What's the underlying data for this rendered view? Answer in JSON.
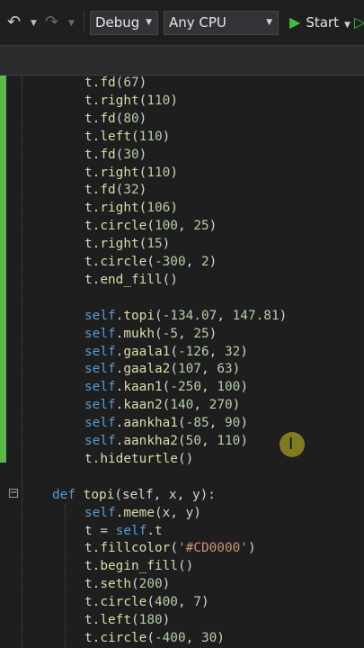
{
  "toolbar": {
    "undo_icon": "undo-icon",
    "redo_icon": "redo-icon",
    "configuration": "Debug",
    "platform": "Any CPU",
    "start_label": "Start",
    "start_icon": "play-icon",
    "accent_color": "#3fbf3f"
  },
  "editor": {
    "change_marker_color": "#5cb84a",
    "lines": [
      {
        "parts": [
          {
            "t": "t.",
            "c": ""
          },
          {
            "t": "fd",
            "c": "fn"
          },
          {
            "t": "(",
            "c": ""
          },
          {
            "t": "67",
            "c": "num"
          },
          {
            "t": ")",
            "c": ""
          }
        ]
      },
      {
        "parts": [
          {
            "t": "t.",
            "c": ""
          },
          {
            "t": "right",
            "c": "fn"
          },
          {
            "t": "(",
            "c": ""
          },
          {
            "t": "110",
            "c": "num"
          },
          {
            "t": ")",
            "c": ""
          }
        ]
      },
      {
        "parts": [
          {
            "t": "t.",
            "c": ""
          },
          {
            "t": "fd",
            "c": "fn"
          },
          {
            "t": "(",
            "c": ""
          },
          {
            "t": "80",
            "c": "num"
          },
          {
            "t": ")",
            "c": ""
          }
        ]
      },
      {
        "parts": [
          {
            "t": "t.",
            "c": ""
          },
          {
            "t": "left",
            "c": "fn"
          },
          {
            "t": "(",
            "c": ""
          },
          {
            "t": "110",
            "c": "num"
          },
          {
            "t": ")",
            "c": ""
          }
        ]
      },
      {
        "parts": [
          {
            "t": "t.",
            "c": ""
          },
          {
            "t": "fd",
            "c": "fn"
          },
          {
            "t": "(",
            "c": ""
          },
          {
            "t": "30",
            "c": "num"
          },
          {
            "t": ")",
            "c": ""
          }
        ]
      },
      {
        "parts": [
          {
            "t": "t.",
            "c": ""
          },
          {
            "t": "right",
            "c": "fn"
          },
          {
            "t": "(",
            "c": ""
          },
          {
            "t": "110",
            "c": "num"
          },
          {
            "t": ")",
            "c": ""
          }
        ]
      },
      {
        "parts": [
          {
            "t": "t.",
            "c": ""
          },
          {
            "t": "fd",
            "c": "fn"
          },
          {
            "t": "(",
            "c": ""
          },
          {
            "t": "32",
            "c": "num"
          },
          {
            "t": ")",
            "c": ""
          }
        ]
      },
      {
        "parts": [
          {
            "t": "t.",
            "c": ""
          },
          {
            "t": "right",
            "c": "fn"
          },
          {
            "t": "(",
            "c": ""
          },
          {
            "t": "106",
            "c": "num"
          },
          {
            "t": ")",
            "c": ""
          }
        ]
      },
      {
        "parts": [
          {
            "t": "t.",
            "c": ""
          },
          {
            "t": "circle",
            "c": "fn"
          },
          {
            "t": "(",
            "c": ""
          },
          {
            "t": "100",
            "c": "num"
          },
          {
            "t": ", ",
            "c": ""
          },
          {
            "t": "25",
            "c": "num"
          },
          {
            "t": ")",
            "c": ""
          }
        ]
      },
      {
        "parts": [
          {
            "t": "t.",
            "c": ""
          },
          {
            "t": "right",
            "c": "fn"
          },
          {
            "t": "(",
            "c": ""
          },
          {
            "t": "15",
            "c": "num"
          },
          {
            "t": ")",
            "c": ""
          }
        ]
      },
      {
        "parts": [
          {
            "t": "t.",
            "c": ""
          },
          {
            "t": "circle",
            "c": "fn"
          },
          {
            "t": "(",
            "c": ""
          },
          {
            "t": "-300",
            "c": "num"
          },
          {
            "t": ", ",
            "c": ""
          },
          {
            "t": "2",
            "c": "num"
          },
          {
            "t": ")",
            "c": ""
          }
        ]
      },
      {
        "parts": [
          {
            "t": "t.",
            "c": ""
          },
          {
            "t": "end_fill",
            "c": "fn"
          },
          {
            "t": "()",
            "c": ""
          }
        ]
      },
      {
        "parts": []
      },
      {
        "parts": [
          {
            "t": "self",
            "c": "self"
          },
          {
            "t": ".",
            "c": ""
          },
          {
            "t": "topi",
            "c": "fn"
          },
          {
            "t": "(",
            "c": ""
          },
          {
            "t": "-134.07",
            "c": "num"
          },
          {
            "t": ", ",
            "c": ""
          },
          {
            "t": "147.81",
            "c": "num"
          },
          {
            "t": ")",
            "c": ""
          }
        ]
      },
      {
        "parts": [
          {
            "t": "self",
            "c": "self"
          },
          {
            "t": ".",
            "c": ""
          },
          {
            "t": "mukh",
            "c": "fn"
          },
          {
            "t": "(",
            "c": ""
          },
          {
            "t": "-5",
            "c": "num"
          },
          {
            "t": ", ",
            "c": ""
          },
          {
            "t": "25",
            "c": "num"
          },
          {
            "t": ")",
            "c": ""
          }
        ]
      },
      {
        "parts": [
          {
            "t": "self",
            "c": "self"
          },
          {
            "t": ".",
            "c": ""
          },
          {
            "t": "gaala1",
            "c": "fn"
          },
          {
            "t": "(",
            "c": ""
          },
          {
            "t": "-126",
            "c": "num"
          },
          {
            "t": ", ",
            "c": ""
          },
          {
            "t": "32",
            "c": "num"
          },
          {
            "t": ")",
            "c": ""
          }
        ]
      },
      {
        "parts": [
          {
            "t": "self",
            "c": "self"
          },
          {
            "t": ".",
            "c": ""
          },
          {
            "t": "gaala2",
            "c": "fn"
          },
          {
            "t": "(",
            "c": ""
          },
          {
            "t": "107",
            "c": "num"
          },
          {
            "t": ", ",
            "c": ""
          },
          {
            "t": "63",
            "c": "num"
          },
          {
            "t": ")",
            "c": ""
          }
        ]
      },
      {
        "parts": [
          {
            "t": "self",
            "c": "self"
          },
          {
            "t": ".",
            "c": ""
          },
          {
            "t": "kaan1",
            "c": "fn"
          },
          {
            "t": "(",
            "c": ""
          },
          {
            "t": "-250",
            "c": "num"
          },
          {
            "t": ", ",
            "c": ""
          },
          {
            "t": "100",
            "c": "num"
          },
          {
            "t": ")",
            "c": ""
          }
        ]
      },
      {
        "parts": [
          {
            "t": "self",
            "c": "self"
          },
          {
            "t": ".",
            "c": ""
          },
          {
            "t": "kaan2",
            "c": "fn"
          },
          {
            "t": "(",
            "c": ""
          },
          {
            "t": "140",
            "c": "num"
          },
          {
            "t": ", ",
            "c": ""
          },
          {
            "t": "270",
            "c": "num"
          },
          {
            "t": ")",
            "c": ""
          }
        ]
      },
      {
        "parts": [
          {
            "t": "self",
            "c": "self"
          },
          {
            "t": ".",
            "c": ""
          },
          {
            "t": "aankha1",
            "c": "fn"
          },
          {
            "t": "(",
            "c": ""
          },
          {
            "t": "-85",
            "c": "num"
          },
          {
            "t": ", ",
            "c": ""
          },
          {
            "t": "90",
            "c": "num"
          },
          {
            "t": ")",
            "c": ""
          }
        ]
      },
      {
        "parts": [
          {
            "t": "self",
            "c": "self"
          },
          {
            "t": ".",
            "c": ""
          },
          {
            "t": "aankha2",
            "c": "fn"
          },
          {
            "t": "(",
            "c": ""
          },
          {
            "t": "50",
            "c": "num"
          },
          {
            "t": ", ",
            "c": ""
          },
          {
            "t": "110",
            "c": "num"
          },
          {
            "t": ")",
            "c": ""
          }
        ]
      },
      {
        "parts": [
          {
            "t": "t.",
            "c": ""
          },
          {
            "t": "hideturtle",
            "c": "fn"
          },
          {
            "t": "()",
            "c": ""
          }
        ]
      },
      {
        "parts": []
      },
      {
        "parts": [
          {
            "t": "def ",
            "c": "kw"
          },
          {
            "t": "topi",
            "c": "fn"
          },
          {
            "t": "(self, x, y):",
            "c": ""
          }
        ]
      },
      {
        "parts": [
          {
            "t": "self",
            "c": "self"
          },
          {
            "t": ".",
            "c": ""
          },
          {
            "t": "meme",
            "c": "fn"
          },
          {
            "t": "(x, y)",
            "c": ""
          }
        ]
      },
      {
        "parts": [
          {
            "t": "t = ",
            "c": ""
          },
          {
            "t": "self",
            "c": "self"
          },
          {
            "t": ".t",
            "c": ""
          }
        ]
      },
      {
        "parts": [
          {
            "t": "t.",
            "c": ""
          },
          {
            "t": "fillcolor",
            "c": "fn"
          },
          {
            "t": "(",
            "c": ""
          },
          {
            "t": "'#CD0000'",
            "c": "str"
          },
          {
            "t": ")",
            "c": ""
          }
        ]
      },
      {
        "parts": [
          {
            "t": "t.",
            "c": ""
          },
          {
            "t": "begin_fill",
            "c": "fn"
          },
          {
            "t": "()",
            "c": ""
          }
        ]
      },
      {
        "parts": [
          {
            "t": "t.",
            "c": ""
          },
          {
            "t": "seth",
            "c": "fn"
          },
          {
            "t": "(",
            "c": ""
          },
          {
            "t": "200",
            "c": "num"
          },
          {
            "t": ")",
            "c": ""
          }
        ]
      },
      {
        "parts": [
          {
            "t": "t.",
            "c": ""
          },
          {
            "t": "circle",
            "c": "fn"
          },
          {
            "t": "(",
            "c": ""
          },
          {
            "t": "400",
            "c": "num"
          },
          {
            "t": ", ",
            "c": ""
          },
          {
            "t": "7",
            "c": "num"
          },
          {
            "t": ")",
            "c": ""
          }
        ]
      },
      {
        "parts": [
          {
            "t": "t.",
            "c": ""
          },
          {
            "t": "left",
            "c": "fn"
          },
          {
            "t": "(",
            "c": ""
          },
          {
            "t": "180",
            "c": "num"
          },
          {
            "t": ")",
            "c": ""
          }
        ]
      },
      {
        "parts": [
          {
            "t": "t.",
            "c": ""
          },
          {
            "t": "circle",
            "c": "fn"
          },
          {
            "t": "(",
            "c": ""
          },
          {
            "t": "-400",
            "c": "num"
          },
          {
            "t": ", ",
            "c": ""
          },
          {
            "t": "30",
            "c": "num"
          },
          {
            "t": ")",
            "c": ""
          }
        ]
      }
    ]
  }
}
